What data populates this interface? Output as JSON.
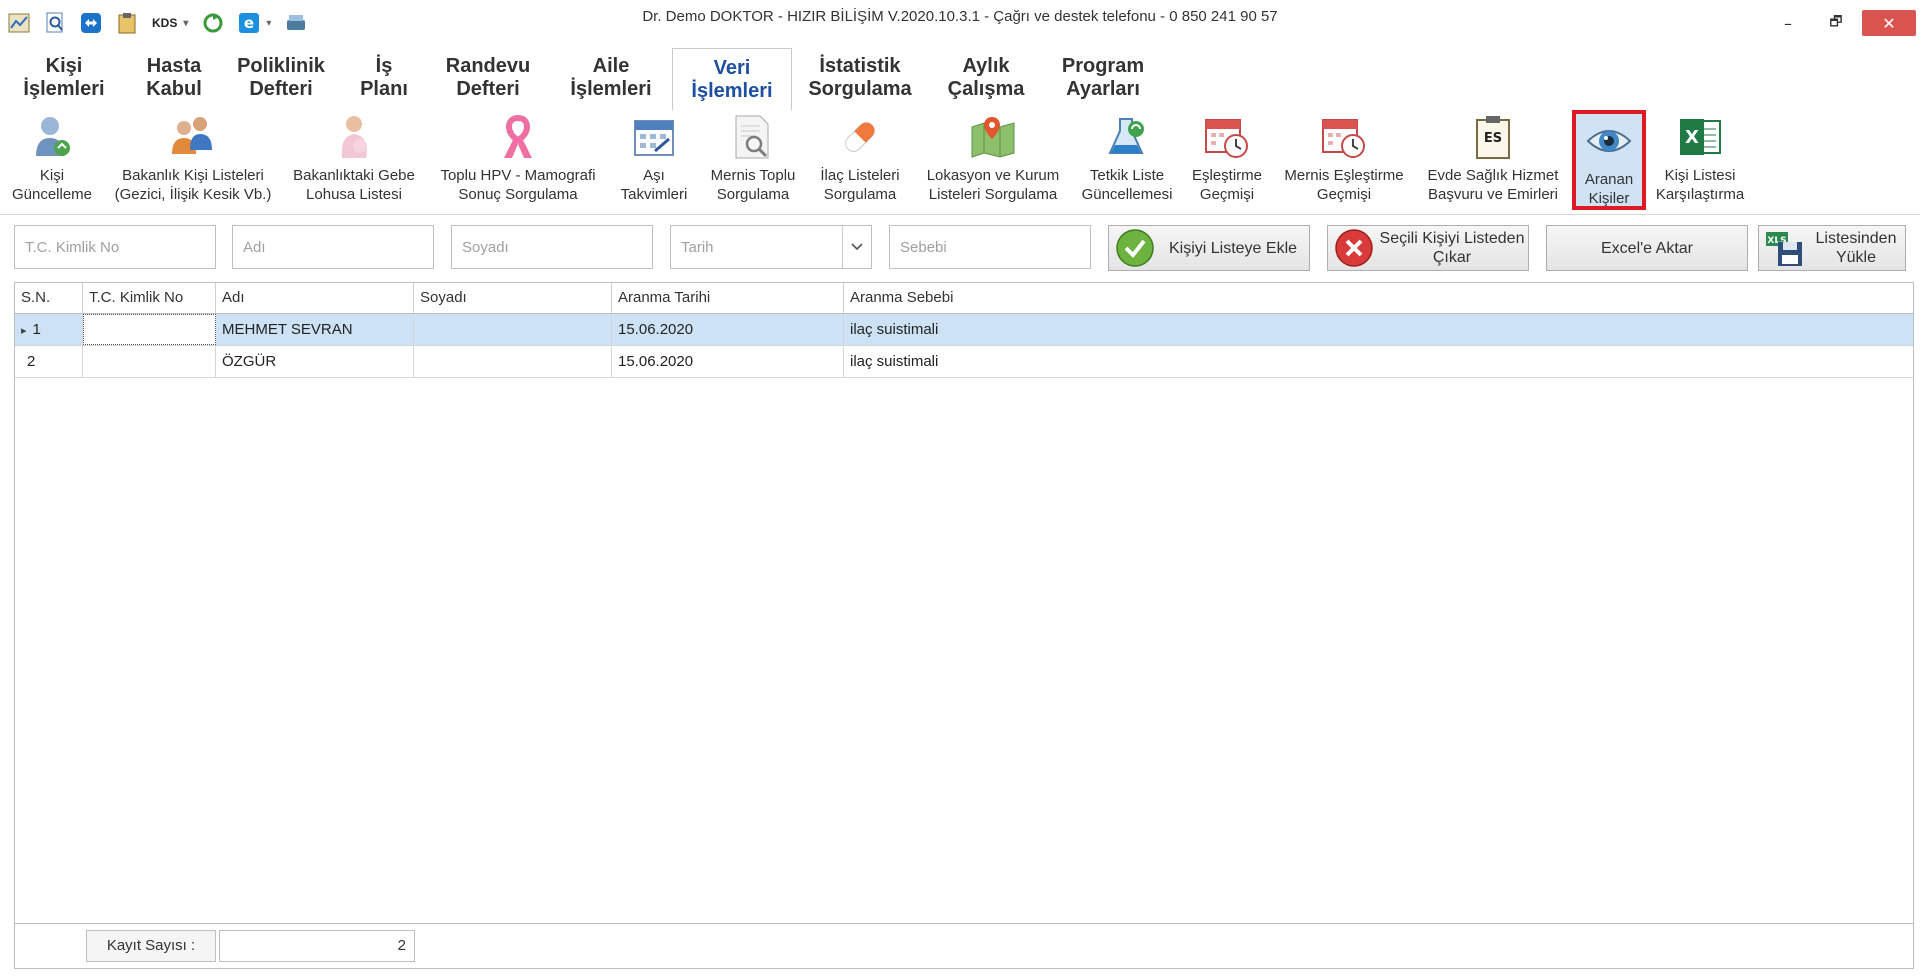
{
  "window": {
    "title": "Dr. Demo DOKTOR - HIZIR BİLİŞİM V.2020.10.3.1 - Çağrı ve destek telefonu - 0 850 241 90 57",
    "minimize": "–",
    "restore": "🗗",
    "close": "✕"
  },
  "quick_access": {
    "kds_label": "KDS",
    "dropdown_glyph": "▾"
  },
  "tabs": [
    {
      "label": "Kişi\nİşlemleri"
    },
    {
      "label": "Hasta\nKabul"
    },
    {
      "label": "Poliklinik\nDefteri"
    },
    {
      "label": "İş\nPlanı"
    },
    {
      "label": "Randevu\nDefteri"
    },
    {
      "label": "Aile\nİşlemleri"
    },
    {
      "label": "Veri\nİşlemleri"
    },
    {
      "label": "İstatistik\nSorgulama"
    },
    {
      "label": "Aylık\nÇalışma"
    },
    {
      "label": "Program\nAyarları"
    }
  ],
  "active_tab": "Veri İşlemleri",
  "ribbon": [
    {
      "label": "Kişi\nGüncelleme",
      "icon": "person-refresh-icon"
    },
    {
      "label": "Bakanlık Kişi Listeleri\n(Gezici, İlişik Kesik Vb.)",
      "icon": "people-group-icon"
    },
    {
      "label": "Bakanlıktaki Gebe\nLohusa Listesi",
      "icon": "pregnant-woman-icon"
    },
    {
      "label": "Toplu HPV - Mamografi\nSonuç Sorgulama",
      "icon": "pink-ribbon-icon"
    },
    {
      "label": "Aşı\nTakvimleri",
      "icon": "calendar-icon"
    },
    {
      "label": "Mernis Toplu\nSorgulama",
      "icon": "document-search-icon"
    },
    {
      "label": "İlaç Listeleri\nSorgulama",
      "icon": "pill-icon"
    },
    {
      "label": "Lokasyon ve Kurum\nListeleri Sorgulama",
      "icon": "map-icon"
    },
    {
      "label": "Tetkik Liste\nGüncellemesi",
      "icon": "lab-refresh-icon"
    },
    {
      "label": "Eşleştirme\nGeçmişi",
      "icon": "calendar-clock-icon"
    },
    {
      "label": "Mernis Eşleştirme\nGeçmişi",
      "icon": "calendar-clock-icon"
    },
    {
      "label": "Evde Sağlık Hizmet\nBaşvuru ve Emirleri",
      "icon": "es-clipboard-icon"
    },
    {
      "label": "Aranan\nKişiler",
      "icon": "eye-icon"
    },
    {
      "label": "Kişi Listesi\nKarşılaştırma",
      "icon": "excel-icon"
    }
  ],
  "form": {
    "tc_placeholder": "T.C. Kimlik No",
    "ad_placeholder": "Adı",
    "soyad_placeholder": "Soyadı",
    "tarih_placeholder": "Tarih",
    "sebep_placeholder": "Sebebi",
    "add_label": "Kişiyi Listeye Ekle",
    "remove_label": "Seçili Kişiyi Listeden\nÇıkar",
    "excel_label": "Excel'e Aktar",
    "load_label": "Listesinden\nYükle"
  },
  "table": {
    "columns": [
      "S.N.",
      "T.C. Kimlik No",
      "Adı",
      "Soyadı",
      "Aranma Tarihi",
      "Aranma Sebebi"
    ],
    "rows": [
      {
        "sn": "1",
        "tc": "",
        "ad": "MEHMET SEVRAN",
        "soyad": "",
        "tarih": "15.06.2020",
        "sebep": "ilaç suistimali"
      },
      {
        "sn": "2",
        "tc": "",
        "ad": "ÖZGÜR",
        "soyad": "",
        "tarih": "15.06.2020",
        "sebep": "ilaç suistimali"
      }
    ],
    "row_indicator": "▸"
  },
  "footer": {
    "count_label": "Kayıt Sayısı :",
    "count_value": "2"
  },
  "colors": {
    "active_tab_text": "#1e4fa0",
    "selected_row": "#cde3f5",
    "highlight_border": "#e01a22"
  }
}
